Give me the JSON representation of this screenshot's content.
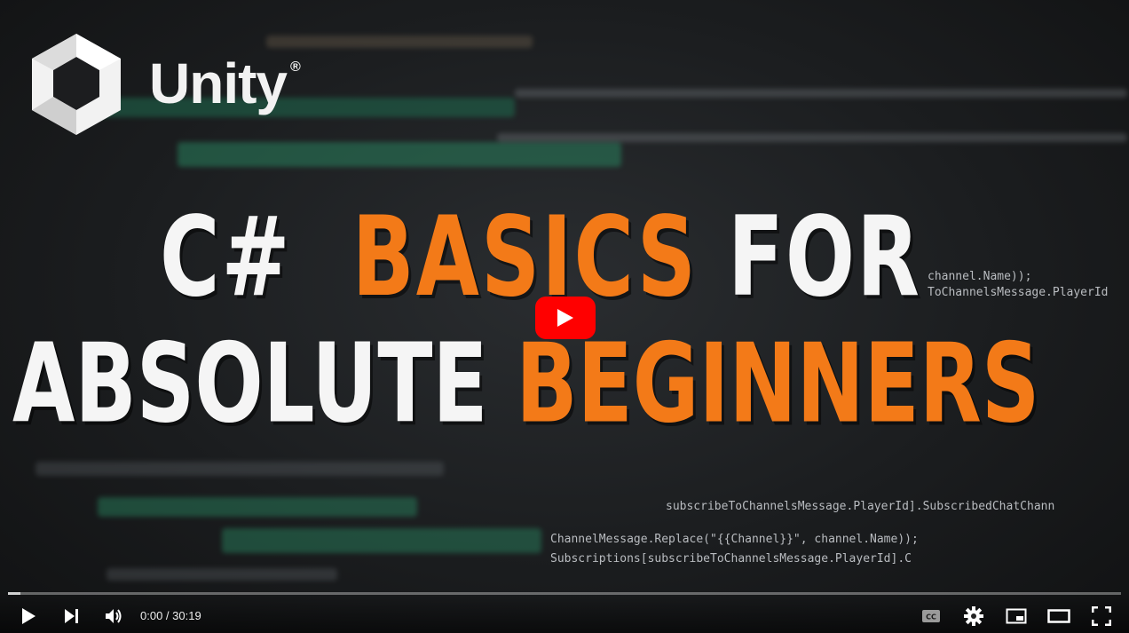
{
  "video": {
    "brand": "Unity",
    "brand_mark": "®",
    "title_line1_white": "C#",
    "title_line1_orange": "BASICS",
    "title_line1_white2": "FOR",
    "title_line2_white": "ABSOLUTE",
    "title_line2_orange": "BEGINNERS",
    "accent_color": "#f37a18"
  },
  "background_code": [
    "channel.Name));",
    "ToChannelsMessage.PlayerId",
    "subscribeToChannelsMessage.PlayerId].SubscribedChatChann",
    "ChannelMessage.Replace(\"{{Channel}}\", channel.Name));",
    "Subscriptions[subscribeToChannelsMessage.PlayerId].C"
  ],
  "player": {
    "current_time": "0:00",
    "separator": " / ",
    "duration": "30:19",
    "progress_fraction": 0.0,
    "play_button_color": "#ff0000",
    "icons": [
      "play-icon",
      "next-icon",
      "volume-icon",
      "captions-icon",
      "settings-icon",
      "miniplayer-icon",
      "theater-icon",
      "fullscreen-icon"
    ]
  }
}
